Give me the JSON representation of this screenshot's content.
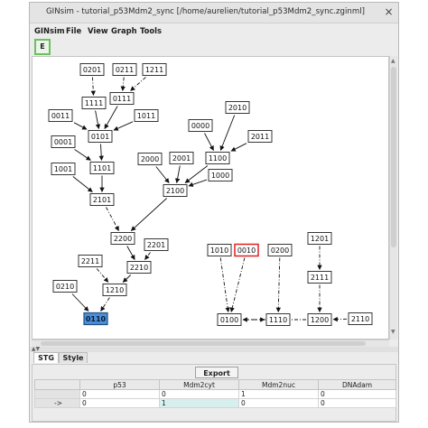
{
  "window": {
    "title": "GINsim - tutorial_p53Mdm2_sync [/home/aurelien/tutorial_p53Mdm2_sync.zginml]",
    "close_glyph": "×"
  },
  "menu": [
    "GINsim",
    "File",
    "View",
    "Graph",
    "Tools"
  ],
  "toolbar": {
    "edit_label": "E"
  },
  "graph": {
    "nodes": [
      {
        "label": "0201"
      },
      {
        "label": "0211"
      },
      {
        "label": "1211"
      },
      {
        "label": "1111"
      },
      {
        "label": "0111"
      },
      {
        "label": "0011"
      },
      {
        "label": "1011"
      },
      {
        "label": "0101"
      },
      {
        "label": "0001"
      },
      {
        "label": "1101"
      },
      {
        "label": "1001"
      },
      {
        "label": "0000"
      },
      {
        "label": "2010"
      },
      {
        "label": "2011"
      },
      {
        "label": "2000"
      },
      {
        "label": "2001"
      },
      {
        "label": "1100"
      },
      {
        "label": "1000"
      },
      {
        "label": "2100"
      },
      {
        "label": "2101"
      },
      {
        "label": "2200"
      },
      {
        "label": "2201"
      },
      {
        "label": "2211"
      },
      {
        "label": "2210"
      },
      {
        "label": "0210"
      },
      {
        "label": "1210"
      },
      {
        "label": "0110",
        "state": "selected"
      },
      {
        "label": "1010"
      },
      {
        "label": "0010",
        "state": "marked"
      },
      {
        "label": "0200"
      },
      {
        "label": "0100"
      },
      {
        "label": "1110"
      },
      {
        "label": "1201"
      },
      {
        "label": "2111"
      },
      {
        "label": "1200"
      },
      {
        "label": "2110"
      }
    ]
  },
  "tabs": [
    {
      "label": "STG",
      "active": true
    },
    {
      "label": "Style",
      "active": false
    }
  ],
  "panel": {
    "export_label": "Export",
    "columns": [
      "",
      "p53",
      "Mdm2cyt",
      "Mdm2nuc",
      "DNAdam"
    ],
    "rows": [
      {
        "label": "",
        "values": [
          "0",
          "0",
          "1",
          "0"
        ]
      },
      {
        "label": "->",
        "values": [
          "0",
          "1",
          "0",
          "0"
        ]
      }
    ]
  },
  "colors": {
    "selected_fill": "#4d8fd6",
    "marked_border": "#e02020",
    "accent_green": "#6cc05f"
  }
}
